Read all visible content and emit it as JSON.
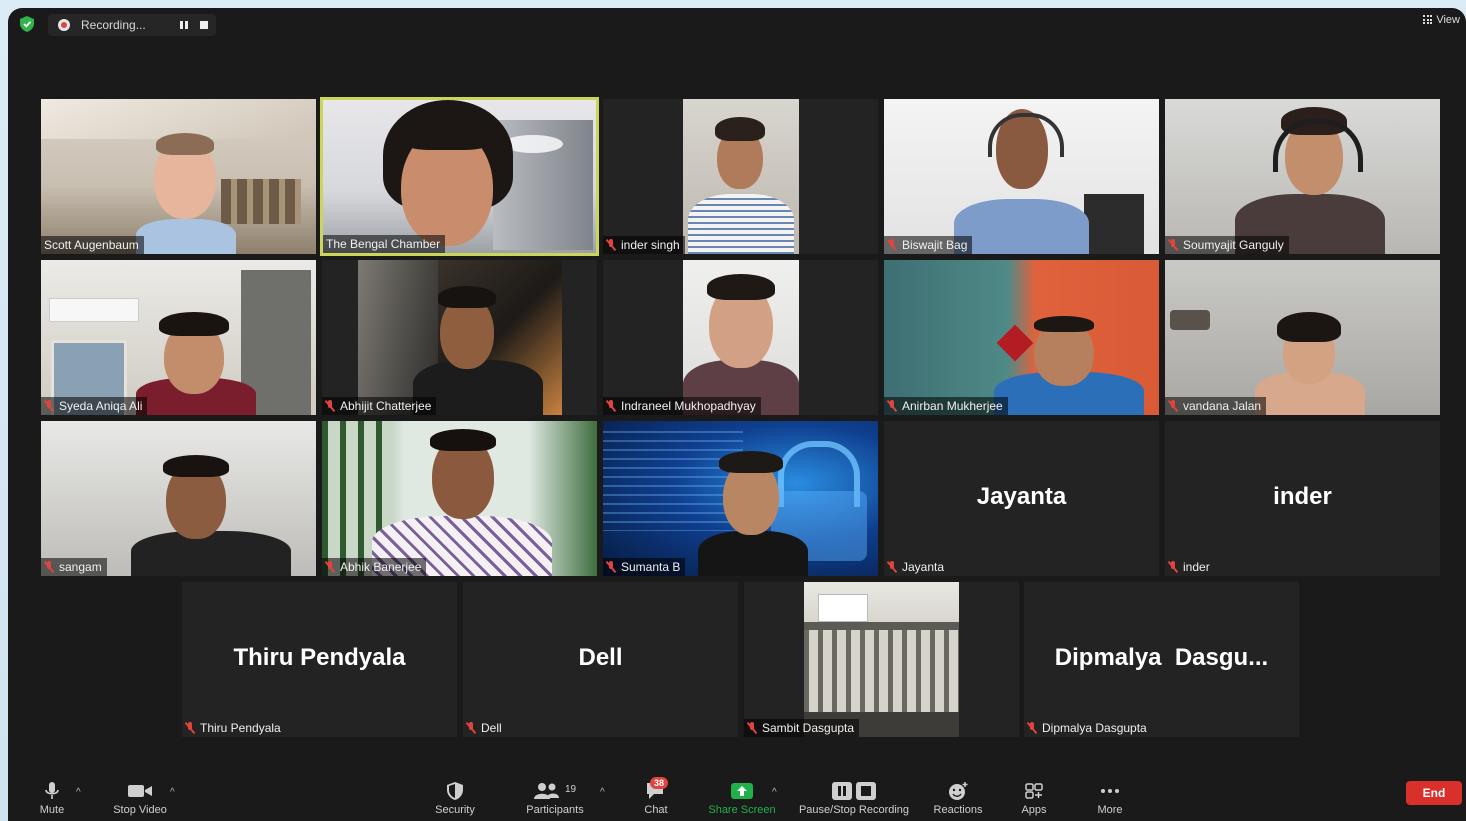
{
  "topbar": {
    "recording_label": "Recording...",
    "view_label": "View"
  },
  "tiles": [
    {
      "name": "Scott Augenbaum",
      "muted": false,
      "speaking": false
    },
    {
      "name": "The Bengal Chamber",
      "muted": false,
      "speaking": true
    },
    {
      "name": "inder singh",
      "muted": true,
      "speaking": false
    },
    {
      "name": "Biswajit Bag",
      "muted": true,
      "speaking": false
    },
    {
      "name": "Soumyajit Ganguly",
      "muted": true,
      "speaking": false
    },
    {
      "name": "Syeda Aniqa Ali",
      "muted": true,
      "speaking": false
    },
    {
      "name": "Abhijit Chatterjee",
      "muted": true,
      "speaking": false
    },
    {
      "name": "Indraneel Mukhopadhyay",
      "muted": true,
      "speaking": false
    },
    {
      "name": "Anirban Mukherjee",
      "muted": true,
      "speaking": false
    },
    {
      "name": "vandana Jalan",
      "muted": true,
      "speaking": false
    },
    {
      "name": "sangam",
      "muted": true,
      "speaking": false
    },
    {
      "name": "Abhik Banerjee",
      "muted": true,
      "speaking": false
    },
    {
      "name": "Sumanta B",
      "muted": true,
      "speaking": false
    },
    {
      "name": "Jayanta",
      "muted": true,
      "speaking": false,
      "display_name": "Jayanta"
    },
    {
      "name": "inder",
      "muted": true,
      "speaking": false,
      "display_name": "inder"
    },
    {
      "name": "Thiru Pendyala",
      "muted": true,
      "speaking": false,
      "display_name": "Thiru Pendyala"
    },
    {
      "name": "Dell",
      "muted": true,
      "speaking": false,
      "display_name": "Dell"
    },
    {
      "name": "Sambit Dasgupta",
      "muted": true,
      "speaking": false
    },
    {
      "name": "Dipmalya Dasgupta",
      "muted": true,
      "speaking": false,
      "display_name": "Dipmalya  Dasgu..."
    }
  ],
  "toolbar": {
    "mute": "Mute",
    "stop_video": "Stop Video",
    "security": "Security",
    "participants": "Participants",
    "participants_count": "19",
    "chat": "Chat",
    "chat_badge": "38",
    "share_screen": "Share Screen",
    "pause_stop_recording": "Pause/Stop Recording",
    "reactions": "Reactions",
    "apps": "Apps",
    "more": "More",
    "end": "End"
  },
  "colors": {
    "background": "#1a1a1a",
    "tile": "#232323",
    "active_speaker": "#c9d65a",
    "muted_red": "#e0443e",
    "share_green": "#22b04b",
    "end_red": "#d9302c"
  }
}
